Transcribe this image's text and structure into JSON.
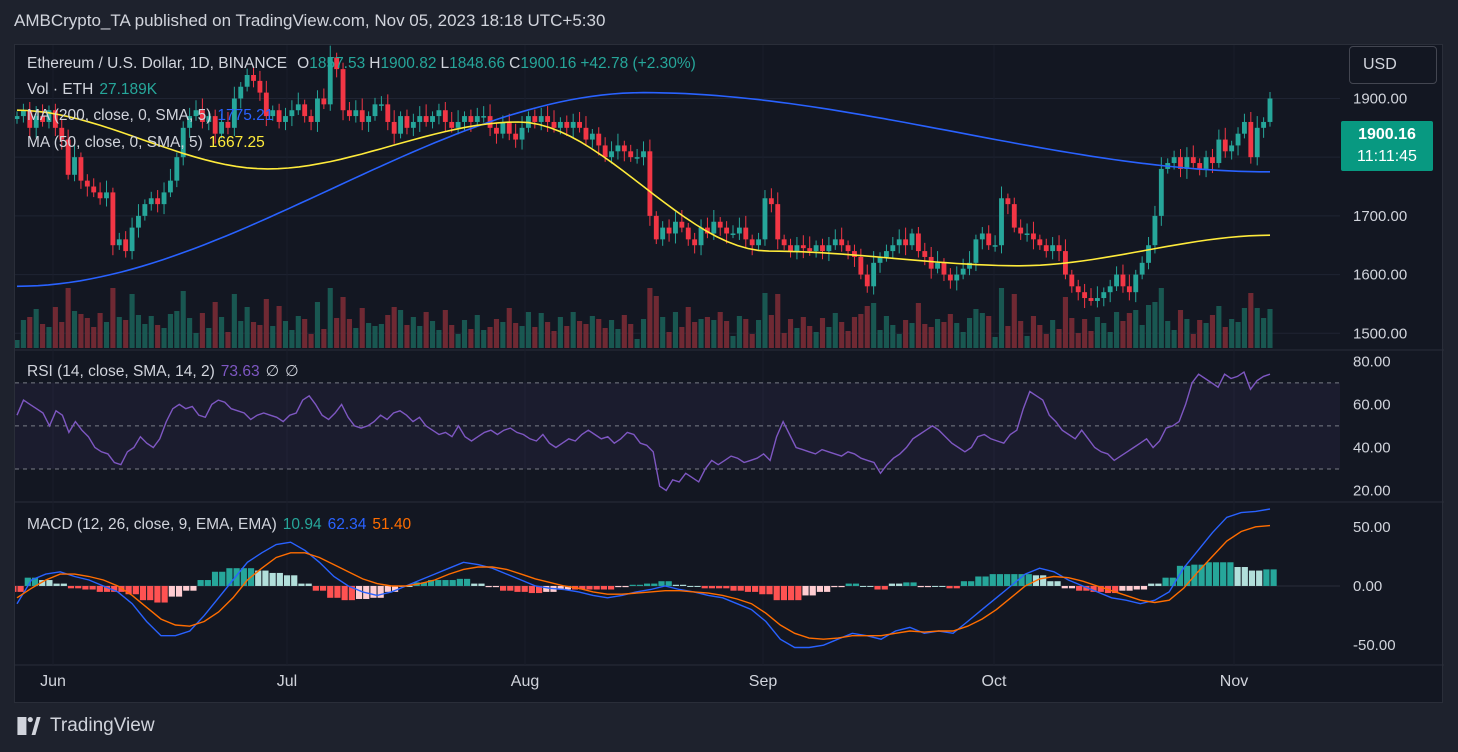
{
  "header": {
    "publisher_line": "AMBCrypto_TA published on TradingView.com, Nov 05, 2023 18:18 UTC+5:30"
  },
  "symbol": {
    "name": "Ethereum / U.S. Dollar, 1D, BINANCE",
    "open_label": "O",
    "open": "1857.53",
    "high_label": "H",
    "high": "1900.82",
    "low_label": "L",
    "low": "1848.66",
    "close_label": "C",
    "close": "1900.16",
    "change": "+42.78 (+2.30%)"
  },
  "legend": {
    "vol_label": "Vol · ETH",
    "vol_value": "27.189K",
    "ma200_label": "MA (200, close, 0, SMA, 5)",
    "ma200_value": "1775.21",
    "ma50_label": "MA (50, close, 0, SMA, 5)",
    "ma50_value": "1667.25",
    "rsi_label": "RSI (14, close, SMA, 14, 2)",
    "rsi_value": "73.63",
    "rsi_extra1": "∅",
    "rsi_extra2": "∅",
    "macd_label": "MACD (12, 26, close, 9, EMA, EMA)",
    "macd_value": "10.94",
    "macd_signal": "62.34",
    "macd_hist": "51.40"
  },
  "currency_button": "USD",
  "price_tag": {
    "price": "1900.16",
    "countdown": "11:11:45"
  },
  "footer": {
    "brand": "TradingView"
  },
  "colors": {
    "up": "#26a69a",
    "down": "#f23645",
    "ma200": "#2962ff",
    "ma50": "#ffeb3b",
    "rsi": "#7e57c2",
    "macd": "#2962ff",
    "signal": "#ff6d00"
  },
  "chart_data": [
    {
      "type": "candlestick",
      "title": "Ethereum / U.S. Dollar, 1D, BINANCE",
      "x_ticks": [
        "Jun",
        "Jul",
        "Aug",
        "Sep",
        "Oct",
        "Nov"
      ],
      "y_ticks": [
        "1500.00",
        "1600.00",
        "1700.00",
        "1800.00",
        "1900.00"
      ],
      "ylim": [
        1480,
        1940
      ],
      "close_path": [
        1870,
        1880,
        1850,
        1870,
        1860,
        1880,
        1850,
        1830,
        1770,
        1800,
        1760,
        1750,
        1740,
        1730,
        1740,
        1650,
        1660,
        1640,
        1680,
        1700,
        1720,
        1730,
        1720,
        1740,
        1760,
        1800,
        1850,
        1870,
        1880,
        1860,
        1870,
        1840,
        1860,
        1850,
        1900,
        1920,
        1940,
        1930,
        1910,
        1870,
        1880,
        1860,
        1870,
        1880,
        1890,
        1870,
        1860,
        1900,
        1890,
        1970,
        1950,
        1880,
        1870,
        1880,
        1860,
        1870,
        1890,
        1890,
        1860,
        1840,
        1870,
        1850,
        1860,
        1870,
        1860,
        1870,
        1880,
        1860,
        1850,
        1860,
        1870,
        1860,
        1870,
        1870,
        1850,
        1840,
        1860,
        1840,
        1830,
        1850,
        1870,
        1860,
        1870,
        1860,
        1850,
        1860,
        1850,
        1860,
        1850,
        1830,
        1840,
        1820,
        1800,
        1810,
        1820,
        1810,
        1800,
        1800,
        1810,
        1700,
        1660,
        1680,
        1670,
        1690,
        1680,
        1660,
        1650,
        1680,
        1670,
        1690,
        1680,
        1670,
        1670,
        1680,
        1660,
        1650,
        1660,
        1730,
        1720,
        1660,
        1650,
        1640,
        1650,
        1645,
        1640,
        1650,
        1640,
        1650,
        1660,
        1650,
        1640,
        1630,
        1600,
        1580,
        1620,
        1630,
        1640,
        1650,
        1660,
        1650,
        1670,
        1640,
        1630,
        1610,
        1620,
        1600,
        1590,
        1600,
        1610,
        1620,
        1660,
        1670,
        1650,
        1650,
        1730,
        1720,
        1680,
        1670,
        1670,
        1660,
        1650,
        1640,
        1650,
        1640,
        1600,
        1580,
        1570,
        1560,
        1555,
        1560,
        1570,
        1580,
        1600,
        1580,
        1570,
        1600,
        1620,
        1650,
        1700,
        1780,
        1790,
        1800,
        1780,
        1800,
        1790,
        1780,
        1800,
        1790,
        1830,
        1810,
        1820,
        1840,
        1860,
        1800,
        1850,
        1860,
        1900
      ],
      "ma200": [
        1580,
        1910,
        1775
      ],
      "ma50": [
        1880,
        1780,
        1860,
        1640,
        1615,
        1667
      ]
    },
    {
      "type": "line",
      "title": "RSI (14, close, SMA, 14, 2)",
      "y_ticks": [
        "20.00",
        "40.00",
        "60.00",
        "80.00"
      ],
      "ylim": [
        17,
        82
      ],
      "bands": [
        30,
        50,
        70
      ],
      "values": [
        55,
        62,
        60,
        58,
        56,
        50,
        57,
        55,
        47,
        52,
        48,
        45,
        40,
        38,
        37,
        33,
        32,
        38,
        40,
        45,
        42,
        40,
        44,
        52,
        58,
        60,
        58,
        59,
        55,
        54,
        60,
        62,
        61,
        58,
        57,
        56,
        53,
        55,
        56,
        55,
        54,
        52,
        55,
        56,
        62,
        64,
        60,
        55,
        53,
        56,
        60,
        54,
        50,
        49,
        50,
        52,
        55,
        53,
        56,
        57,
        55,
        52,
        54,
        50,
        48,
        46,
        47,
        45,
        50,
        45,
        43,
        45,
        47,
        48,
        46,
        48,
        49,
        47,
        46,
        44,
        43,
        46,
        42,
        40,
        42,
        44,
        43,
        46,
        48,
        46,
        44,
        45,
        42,
        44,
        47,
        46,
        42,
        41,
        38,
        22,
        20,
        25,
        24,
        28,
        26,
        24,
        30,
        34,
        32,
        34,
        36,
        35,
        33,
        34,
        35,
        37,
        34,
        45,
        52,
        46,
        40,
        39,
        38,
        37,
        39,
        38,
        37,
        36,
        38,
        37,
        35,
        34,
        33,
        28,
        32,
        35,
        37,
        40,
        44,
        46,
        48,
        50,
        48,
        45,
        42,
        40,
        38,
        40,
        45,
        46,
        44,
        43,
        42,
        46,
        48,
        58,
        66,
        64,
        62,
        55,
        52,
        48,
        46,
        44,
        48,
        44,
        40,
        38,
        37,
        34,
        36,
        38,
        40,
        42,
        44,
        40,
        43,
        49,
        50,
        52,
        60,
        70,
        74,
        72,
        70,
        68,
        74,
        72,
        73,
        75,
        67,
        71,
        73,
        74
      ]
    },
    {
      "type": "line",
      "title": "MACD (12, 26, close, 9, EMA, EMA)",
      "y_ticks": [
        "-50.00",
        "0.00",
        "50.00"
      ],
      "ylim": [
        -60,
        65
      ],
      "macd": [
        -15,
        5,
        10,
        12,
        8,
        5,
        0,
        -5,
        -15,
        -30,
        -42,
        -42,
        -38,
        -25,
        -10,
        5,
        20,
        28,
        35,
        37,
        30,
        20,
        8,
        0,
        -5,
        -8,
        -5,
        0,
        5,
        10,
        15,
        20,
        18,
        15,
        10,
        5,
        0,
        -2,
        -3,
        -5,
        -8,
        -10,
        -8,
        -5,
        -3,
        0,
        -3,
        -5,
        -8,
        -10,
        -15,
        -20,
        -30,
        -45,
        -52,
        -52,
        -50,
        -45,
        -40,
        -42,
        -45,
        -38,
        -35,
        -40,
        -38,
        -40,
        -30,
        -20,
        -10,
        0,
        10,
        15,
        12,
        5,
        0,
        -5,
        -10,
        -12,
        -15,
        -12,
        -5,
        15,
        30,
        45,
        58,
        62,
        63,
        65
      ],
      "signal": [
        -10,
        -2,
        5,
        10,
        10,
        8,
        5,
        0,
        -8,
        -18,
        -28,
        -33,
        -34,
        -30,
        -22,
        -10,
        5,
        15,
        24,
        28,
        28,
        24,
        18,
        12,
        6,
        2,
        0,
        0,
        2,
        5,
        10,
        14,
        16,
        16,
        14,
        10,
        6,
        3,
        0,
        -2,
        -5,
        -7,
        -7,
        -6,
        -5,
        -4,
        -4,
        -5,
        -6,
        -8,
        -11,
        -15,
        -23,
        -33,
        -40,
        -44,
        -45,
        -44,
        -42,
        -42,
        -42,
        -40,
        -38,
        -39,
        -38,
        -38,
        -34,
        -28,
        -20,
        -10,
        0,
        6,
        8,
        7,
        4,
        0,
        -4,
        -8,
        -12,
        -14,
        -12,
        -2,
        12,
        25,
        38,
        46,
        50,
        51
      ]
    }
  ]
}
